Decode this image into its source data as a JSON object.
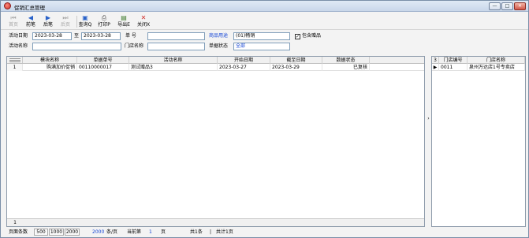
{
  "window": {
    "title": "促销汇总管理"
  },
  "titlebar_buttons": {
    "minimize": "—",
    "restore": "□",
    "close": "✕"
  },
  "toolbar": {
    "items": [
      {
        "label": "首页",
        "icon": "first-page-icon",
        "enabled": false
      },
      {
        "label": "前笔",
        "icon": "previous-icon",
        "enabled": true
      },
      {
        "label": "后笔",
        "icon": "next-icon",
        "enabled": true
      },
      {
        "label": "后页",
        "icon": "last-page-icon",
        "enabled": false
      },
      {
        "label": "查询Q",
        "icon": "query-icon",
        "enabled": true
      },
      {
        "label": "打印P",
        "icon": "printer-icon",
        "enabled": true
      },
      {
        "label": "导出E",
        "icon": "export-icon",
        "enabled": true
      },
      {
        "label": "关闭X",
        "icon": "close-icon",
        "enabled": true
      }
    ]
  },
  "filters": {
    "date_label": "活动日期",
    "date_from": "2023-03-28",
    "to_label": "至",
    "date_to": "2023-03-28",
    "doc_no_label": "单    号",
    "doc_no_value": "",
    "purpose_label": "商品用途",
    "purpose_value": "(01)畅销",
    "gift_checkbox_label": "包含赠品",
    "gift_checked": true,
    "activity_name_label": "活动名称",
    "activity_name_value": "",
    "store_name_label": "门店名称",
    "store_name_value": "",
    "status_label": "单据状态",
    "status_value": "全部"
  },
  "main_table": {
    "columns": [
      "模块名称",
      "单据单号",
      "活动名称",
      "开始日期",
      "截至日期",
      "数据状态"
    ],
    "rows": [
      {
        "index": "1",
        "module": "购满加价促销",
        "doc_no": "00110000017",
        "activity": "测试赠品3",
        "start": "2023-03-27",
        "end": "2023-03-29",
        "status": "已复核"
      }
    ],
    "footer_count": "1"
  },
  "side_table": {
    "row_count_header": "3",
    "columns": [
      "门店编号",
      "门店名称"
    ],
    "rows": [
      {
        "marker": "▶",
        "store_no": "0011",
        "store_name": "泉州万达店1号专卖店"
      }
    ]
  },
  "pager": {
    "page_size_label": "页面条数",
    "size_options": [
      "500",
      "1000",
      "2000"
    ],
    "current_size": "2000",
    "per_page_unit": "条/页",
    "current_page_label": "当前第",
    "current_page": "1",
    "page_unit": "页",
    "total_records": "共1条",
    "separator": "|",
    "total_pages": "共计1页"
  },
  "colors": {
    "accent_blue": "#1747d6",
    "border": "#8d9bab"
  }
}
